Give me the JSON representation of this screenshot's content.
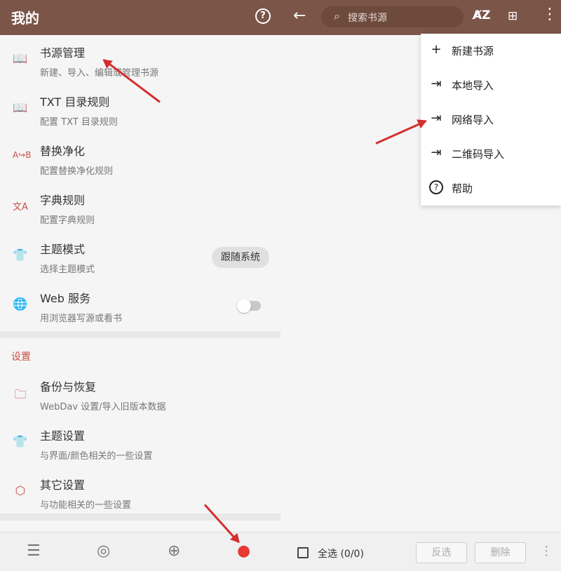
{
  "left": {
    "title": "我的",
    "help_icon": "help-circle-icon",
    "items": [
      {
        "title": "书源管理",
        "sub": "新建、导入、编辑或管理书源",
        "icon": "book-open-icon"
      },
      {
        "title": "TXT 目录规则",
        "sub": "配置 TXT 目录规则",
        "icon": "book-open-icon"
      },
      {
        "title": "替换净化",
        "sub": "配置替换净化规则",
        "icon": "replace-ab-icon"
      },
      {
        "title": "字典规则",
        "sub": "配置字典规则",
        "icon": "translate-icon"
      },
      {
        "title": "主题模式",
        "sub": "选择主题模式",
        "icon": "shirt-icon"
      },
      {
        "title": "Web 服务",
        "sub": "用浏览器写源或看书",
        "icon": "globe-icon"
      }
    ],
    "theme_mode_value": "跟随系统",
    "web_service_enabled": false,
    "section_title": "设置",
    "settings": [
      {
        "title": "备份与恢复",
        "sub": "WebDav 设置/导入旧版本数据",
        "icon": "folder-icon"
      },
      {
        "title": "主题设置",
        "sub": "与界面/颜色相关的一些设置",
        "icon": "shirt-icon"
      },
      {
        "title": "其它设置",
        "sub": "与功能相关的一些设置",
        "icon": "hexagon-settings-icon"
      }
    ],
    "bottom_nav": [
      "bookshelf-icon",
      "compass-icon",
      "bookmark-plus-icon",
      "person-icon"
    ]
  },
  "right": {
    "search_placeholder": "搜索书源",
    "menu": [
      {
        "label": "新建书源",
        "icon": "plus-icon"
      },
      {
        "label": "本地导入",
        "icon": "import-icon"
      },
      {
        "label": "网络导入",
        "icon": "import-icon"
      },
      {
        "label": "二维码导入",
        "icon": "import-icon"
      },
      {
        "label": "帮助",
        "icon": "help-circle-icon"
      }
    ],
    "select_all": "全选 (0/0)",
    "invert_button": "反选",
    "delete_button": "删除"
  },
  "colors": {
    "header": "#7a5548",
    "accent": "#c84f46",
    "arrow": "#d32f2f"
  }
}
